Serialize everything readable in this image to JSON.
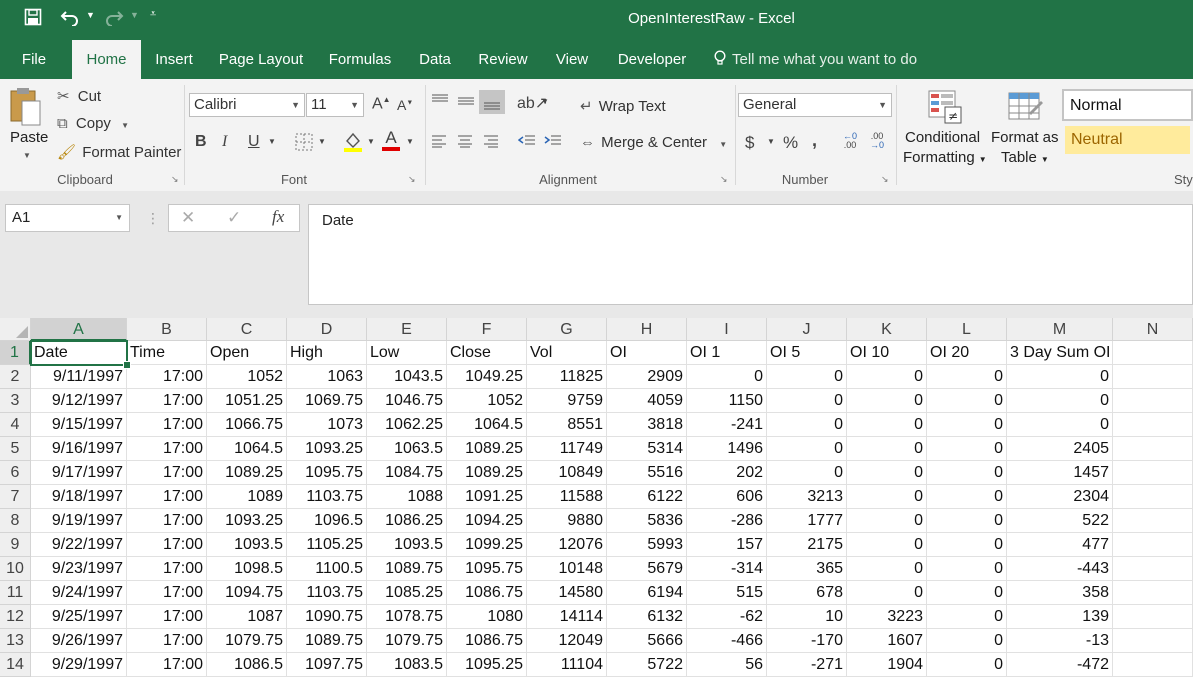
{
  "window": {
    "title": "OpenInterestRaw  -  Excel"
  },
  "tabs": [
    "File",
    "Home",
    "Insert",
    "Page Layout",
    "Formulas",
    "Data",
    "Review",
    "View",
    "Developer"
  ],
  "tell_me": "Tell me what you want to do",
  "ribbon": {
    "clipboard": {
      "label": "Clipboard",
      "paste": "Paste",
      "cut": "Cut",
      "copy": "Copy",
      "format_painter": "Format Painter"
    },
    "font": {
      "label": "Font",
      "family": "Calibri",
      "size": "11",
      "bold": "B",
      "italic": "I",
      "underline": "U"
    },
    "alignment": {
      "label": "Alignment",
      "wrap_text": "Wrap Text",
      "merge_center": "Merge & Center"
    },
    "number": {
      "label": "Number",
      "format": "General",
      "currency": "$",
      "percent": "%",
      "comma": ","
    },
    "styles": {
      "conditional_formatting_1": "Conditional",
      "conditional_formatting_2": "Formatting",
      "format_as_table_1": "Format as",
      "format_as_table_2": "Table",
      "normal": "Normal",
      "neutral": "Neutral",
      "label": "Sty"
    }
  },
  "name_box": "A1",
  "formula": "Date",
  "colors": {
    "excel_green": "#217346",
    "neutral_fill": "#ffeb9c",
    "neutral_text": "#9c6500"
  },
  "grid": {
    "columns": [
      "A",
      "B",
      "C",
      "D",
      "E",
      "F",
      "G",
      "H",
      "I",
      "J",
      "K",
      "L",
      "M",
      "N"
    ],
    "row_numbers": [
      "1",
      "2",
      "3",
      "4",
      "5",
      "6",
      "7",
      "8",
      "9",
      "10",
      "11",
      "12",
      "13",
      "14"
    ],
    "rows": [
      [
        "Date",
        "Time",
        "Open",
        "High",
        "Low",
        "Close",
        "Vol",
        "OI",
        "OI 1",
        "OI 5",
        "OI 10",
        "OI 20",
        "3 Day Sum OI",
        ""
      ],
      [
        "9/11/1997",
        "17:00",
        "1052",
        "1063",
        "1043.5",
        "1049.25",
        "11825",
        "2909",
        "0",
        "0",
        "0",
        "0",
        "0",
        ""
      ],
      [
        "9/12/1997",
        "17:00",
        "1051.25",
        "1069.75",
        "1046.75",
        "1052",
        "9759",
        "4059",
        "1150",
        "0",
        "0",
        "0",
        "0",
        ""
      ],
      [
        "9/15/1997",
        "17:00",
        "1066.75",
        "1073",
        "1062.25",
        "1064.5",
        "8551",
        "3818",
        "-241",
        "0",
        "0",
        "0",
        "0",
        ""
      ],
      [
        "9/16/1997",
        "17:00",
        "1064.5",
        "1093.25",
        "1063.5",
        "1089.25",
        "11749",
        "5314",
        "1496",
        "0",
        "0",
        "0",
        "2405",
        ""
      ],
      [
        "9/17/1997",
        "17:00",
        "1089.25",
        "1095.75",
        "1084.75",
        "1089.25",
        "10849",
        "5516",
        "202",
        "0",
        "0",
        "0",
        "1457",
        ""
      ],
      [
        "9/18/1997",
        "17:00",
        "1089",
        "1103.75",
        "1088",
        "1091.25",
        "11588",
        "6122",
        "606",
        "3213",
        "0",
        "0",
        "2304",
        ""
      ],
      [
        "9/19/1997",
        "17:00",
        "1093.25",
        "1096.5",
        "1086.25",
        "1094.25",
        "9880",
        "5836",
        "-286",
        "1777",
        "0",
        "0",
        "522",
        ""
      ],
      [
        "9/22/1997",
        "17:00",
        "1093.5",
        "1105.25",
        "1093.5",
        "1099.25",
        "12076",
        "5993",
        "157",
        "2175",
        "0",
        "0",
        "477",
        ""
      ],
      [
        "9/23/1997",
        "17:00",
        "1098.5",
        "1100.5",
        "1089.75",
        "1095.75",
        "10148",
        "5679",
        "-314",
        "365",
        "0",
        "0",
        "-443",
        ""
      ],
      [
        "9/24/1997",
        "17:00",
        "1094.75",
        "1103.75",
        "1085.25",
        "1086.75",
        "14580",
        "6194",
        "515",
        "678",
        "0",
        "0",
        "358",
        ""
      ],
      [
        "9/25/1997",
        "17:00",
        "1087",
        "1090.75",
        "1078.75",
        "1080",
        "14114",
        "6132",
        "-62",
        "10",
        "3223",
        "0",
        "139",
        ""
      ],
      [
        "9/26/1997",
        "17:00",
        "1079.75",
        "1089.75",
        "1079.75",
        "1086.75",
        "12049",
        "5666",
        "-466",
        "-170",
        "1607",
        "0",
        "-13",
        ""
      ],
      [
        "9/29/1997",
        "17:00",
        "1086.5",
        "1097.75",
        "1083.5",
        "1095.25",
        "11104",
        "5722",
        "56",
        "-271",
        "1904",
        "0",
        "-472",
        ""
      ]
    ]
  }
}
